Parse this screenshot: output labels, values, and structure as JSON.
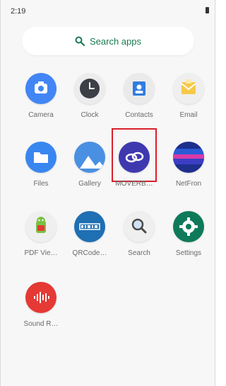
{
  "status_bar": {
    "time": "2:19"
  },
  "search": {
    "placeholder": "Search apps"
  },
  "apps": [
    {
      "label": "Camera"
    },
    {
      "label": "Clock"
    },
    {
      "label": "Contacts"
    },
    {
      "label": "Email"
    },
    {
      "label": "Files"
    },
    {
      "label": "Gallery"
    },
    {
      "label": "MOVERB…"
    },
    {
      "label": "NetFron"
    },
    {
      "label": "PDF Vie…"
    },
    {
      "label": "QRCode…"
    },
    {
      "label": "Search"
    },
    {
      "label": "Settings"
    },
    {
      "label": "Sound R…"
    }
  ],
  "colors": {
    "search_accent": "#1a7a4f",
    "highlight_box": "#d8202a"
  }
}
